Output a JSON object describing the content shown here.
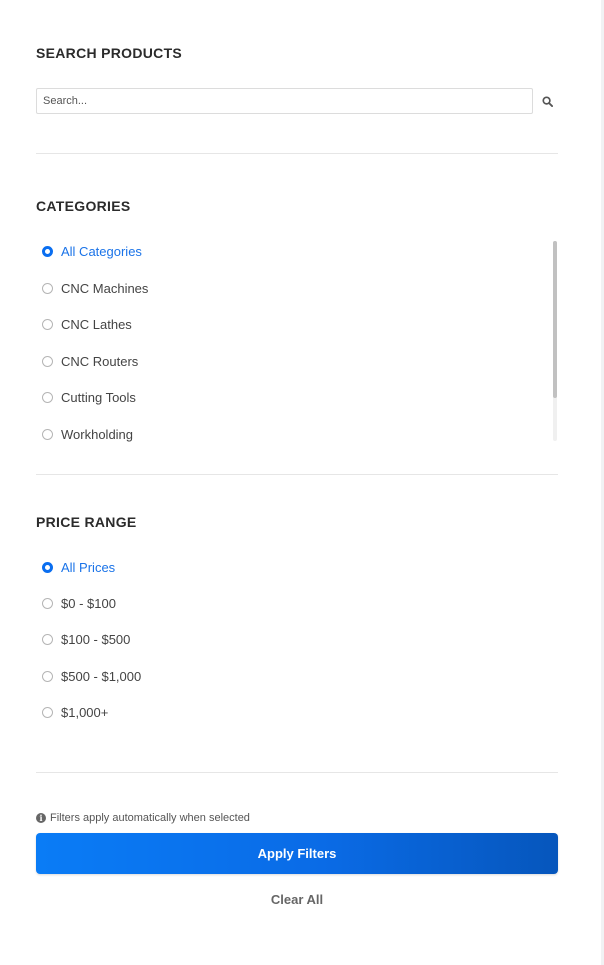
{
  "search": {
    "title": "SEARCH PRODUCTS",
    "placeholder": "Search...",
    "value": ""
  },
  "categories": {
    "title": "CATEGORIES",
    "items": [
      {
        "label": "All Categories",
        "checked": true
      },
      {
        "label": "CNC Machines",
        "checked": false
      },
      {
        "label": "CNC Lathes",
        "checked": false
      },
      {
        "label": "CNC Routers",
        "checked": false
      },
      {
        "label": "Cutting Tools",
        "checked": false
      },
      {
        "label": "Workholding",
        "checked": false
      }
    ]
  },
  "price": {
    "title": "PRICE RANGE",
    "items": [
      {
        "label": "All Prices",
        "checked": true
      },
      {
        "label": "$0 - $100",
        "checked": false
      },
      {
        "label": "$100 - $500",
        "checked": false
      },
      {
        "label": "$500 - $1,000",
        "checked": false
      },
      {
        "label": "$1,000+",
        "checked": false
      }
    ]
  },
  "footer": {
    "info_text": "Filters apply automatically when selected",
    "apply_label": "Apply Filters",
    "clear_label": "Clear All"
  },
  "colors": {
    "accent": "#0a6ef0",
    "accent_dark": "#0656bc"
  },
  "icons": {
    "search": "search-icon",
    "info": "info-icon"
  }
}
